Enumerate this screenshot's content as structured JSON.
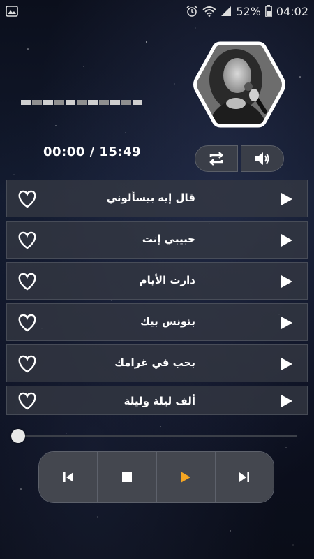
{
  "status_bar": {
    "battery": "52%",
    "time": "04:02",
    "icons": [
      "gallery-icon",
      "alarm-icon",
      "wifi-icon",
      "signal-icon",
      "battery-icon"
    ]
  },
  "player": {
    "elapsed_label": "00:00 / 15:49",
    "equalizer_bars": 11,
    "seek_progress": 0,
    "artist_photo": "artist-photo"
  },
  "songs": [
    {
      "title": "قال إيه بيسألوني"
    },
    {
      "title": "حبيبي إنت"
    },
    {
      "title": "دارت الأيام"
    },
    {
      "title": "بتونس بيك"
    },
    {
      "title": "بحب في غرامك"
    },
    {
      "title": "ألف ليلة وليلة"
    }
  ],
  "controls": {
    "top": [
      "repeat-icon",
      "volume-icon"
    ],
    "transport": [
      "previous-icon",
      "stop-icon",
      "play-icon",
      "next-icon"
    ],
    "accent_color": "#f5a623"
  }
}
